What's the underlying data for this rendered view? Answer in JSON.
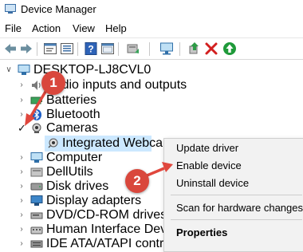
{
  "window": {
    "title": "Device Manager"
  },
  "menu": [
    "File",
    "Action",
    "View",
    "Help"
  ],
  "toolbar": {
    "icons": [
      "back-arrow-icon",
      "forward-arrow-icon",
      "properties-icon",
      "show-hidden-icon",
      "help-icon",
      "window-icon",
      "update-driver-icon",
      "scan-hardware-icon",
      "enable-device-icon",
      "uninstall-icon",
      "add-legacy-icon"
    ]
  },
  "tree": {
    "root": "DESKTOP-LJ8CVL0",
    "items": [
      {
        "label": "Audio inputs and outputs",
        "icon": "speaker-icon"
      },
      {
        "label": "Batteries",
        "icon": "battery-icon"
      },
      {
        "label": "Bluetooth",
        "icon": "bluetooth-icon"
      },
      {
        "label": "Cameras",
        "icon": "camera-icon"
      },
      {
        "label": "Integrated Webcam",
        "icon": "webcam-icon"
      },
      {
        "label": "Computer",
        "icon": "computer-icon"
      },
      {
        "label": "DellUtils",
        "icon": "device-icon"
      },
      {
        "label": "Disk drives",
        "icon": "disk-icon"
      },
      {
        "label": "Display adapters",
        "icon": "monitor-icon"
      },
      {
        "label": "DVD/CD-ROM drives",
        "icon": "dvd-icon"
      },
      {
        "label": "Human Interface Devic",
        "icon": "hid-icon"
      },
      {
        "label": "IDE ATA/ATAPI controllers",
        "icon": "ide-icon"
      }
    ]
  },
  "context_menu": {
    "items": [
      "Update driver",
      "Enable device",
      "Uninstall device",
      "Scan for hardware changes",
      "Properties"
    ]
  },
  "annotations": {
    "badge1": "1",
    "badge2": "2"
  },
  "colors": {
    "selection": "#cce8ff",
    "badge": "#d9473c",
    "arrow": "#e0473d"
  }
}
